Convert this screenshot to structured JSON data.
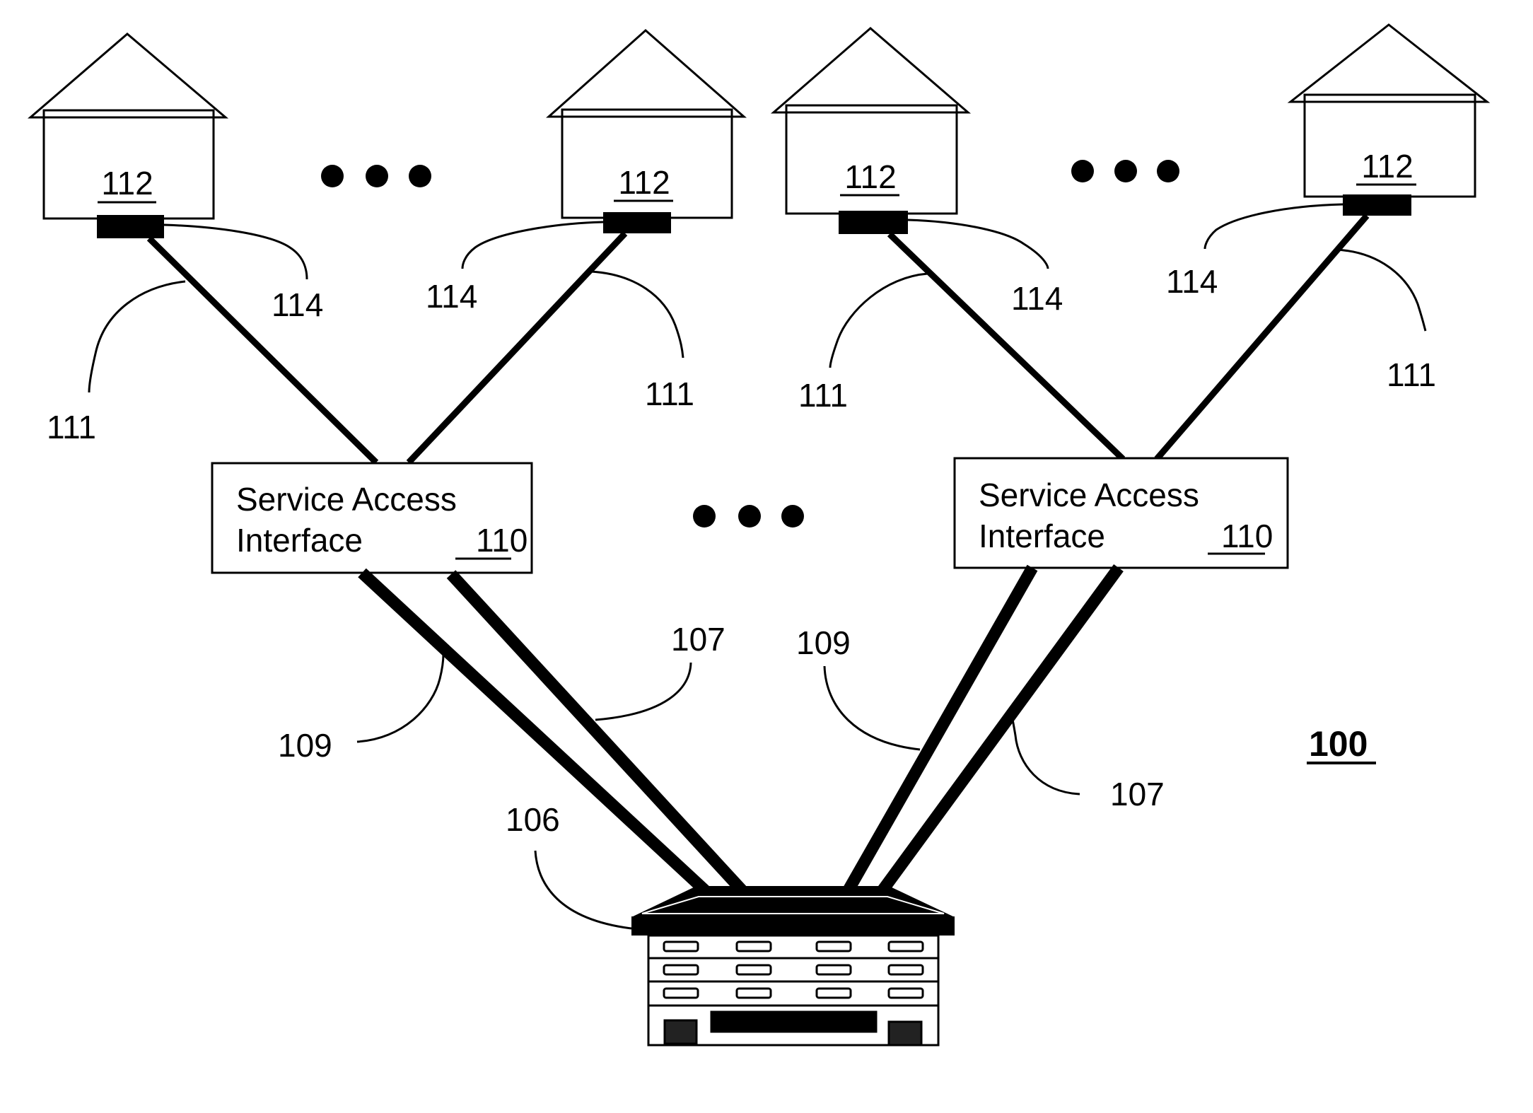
{
  "figure": {
    "title_ref": "100",
    "colors": {
      "ink": "#000000",
      "paper": "#ffffff"
    }
  },
  "premises": [
    {
      "ref": "112",
      "connector_ref": "114",
      "drop_ref": "111"
    },
    {
      "ref": "112",
      "connector_ref": "114",
      "drop_ref": "111"
    },
    {
      "ref": "112",
      "connector_ref": "114",
      "drop_ref": "111"
    },
    {
      "ref": "112",
      "connector_ref": "114",
      "drop_ref": "111"
    }
  ],
  "service_access_interfaces": [
    {
      "line1": "Service Access",
      "line2": "Interface",
      "ref": "110",
      "link_refs": [
        "109",
        "107"
      ]
    },
    {
      "line1": "Service Access",
      "line2": "Interface",
      "ref": "110",
      "link_refs": [
        "109",
        "107"
      ]
    }
  ],
  "central_node": {
    "ref": "106"
  },
  "ellipses": [
    {
      "name": "more-premises-left",
      "glyph": "•••"
    },
    {
      "name": "more-premises-right",
      "glyph": "•••"
    },
    {
      "name": "more-interfaces",
      "glyph": "•••"
    }
  ]
}
